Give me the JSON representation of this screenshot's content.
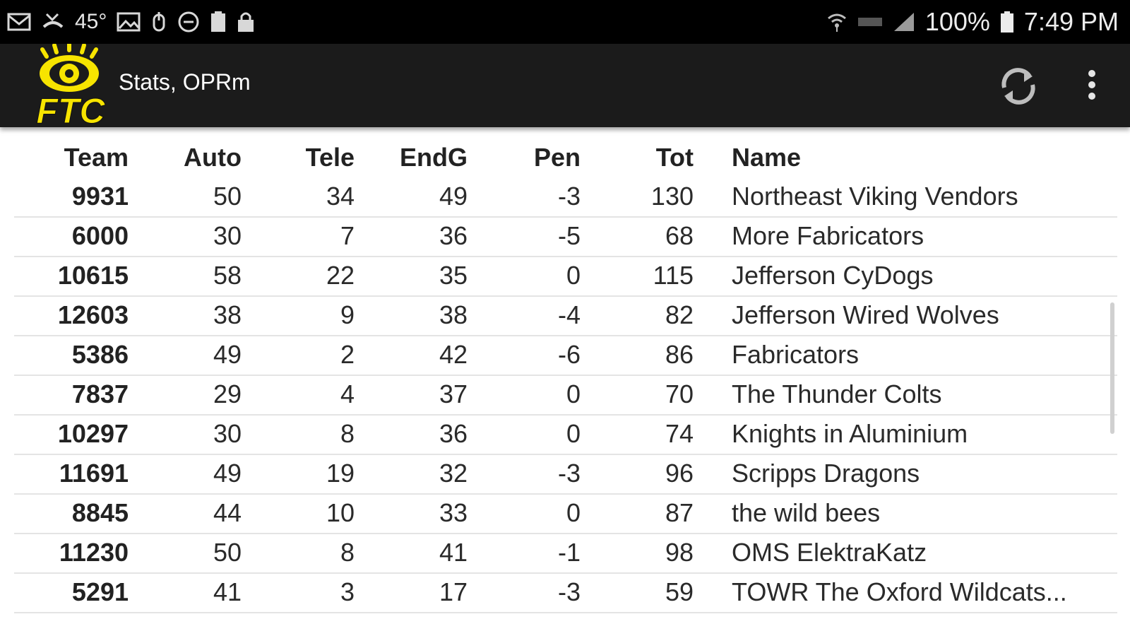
{
  "status_bar": {
    "temperature": "45°",
    "battery": "100%",
    "time": "7:49 PM",
    "left_icons": [
      "mail-icon",
      "missed-call-icon",
      "temperature-icon",
      "image-icon",
      "accessibility-icon",
      "do-not-disturb-icon",
      "clipboard-icon",
      "lock-icon"
    ],
    "right_icons": [
      "wifi-icon",
      "lte-icon",
      "signal-icon",
      "battery-icon"
    ]
  },
  "app_bar": {
    "title": "Stats, OPRm",
    "logo_text": "FTC",
    "accent_color": "#f7e400",
    "background": "#1b1b1b"
  },
  "table": {
    "headers": {
      "team": "Team",
      "auto": "Auto",
      "tele": "Tele",
      "endg": "EndG",
      "pen": "Pen",
      "tot": "Tot",
      "name": "Name"
    },
    "rows": [
      {
        "team": "9931",
        "auto": "50",
        "tele": "34",
        "endg": "49",
        "pen": "-3",
        "tot": "130",
        "name": "Northeast Viking Vendors"
      },
      {
        "team": "6000",
        "auto": "30",
        "tele": "7",
        "endg": "36",
        "pen": "-5",
        "tot": "68",
        "name": "More Fabricators"
      },
      {
        "team": "10615",
        "auto": "58",
        "tele": "22",
        "endg": "35",
        "pen": "0",
        "tot": "115",
        "name": "Jefferson CyDogs"
      },
      {
        "team": "12603",
        "auto": "38",
        "tele": "9",
        "endg": "38",
        "pen": "-4",
        "tot": "82",
        "name": "Jefferson Wired Wolves"
      },
      {
        "team": "5386",
        "auto": "49",
        "tele": "2",
        "endg": "42",
        "pen": "-6",
        "tot": "86",
        "name": "Fabricators"
      },
      {
        "team": "7837",
        "auto": "29",
        "tele": "4",
        "endg": "37",
        "pen": "0",
        "tot": "70",
        "name": "The Thunder Colts"
      },
      {
        "team": "10297",
        "auto": "30",
        "tele": "8",
        "endg": "36",
        "pen": "0",
        "tot": "74",
        "name": "Knights in Aluminium"
      },
      {
        "team": "11691",
        "auto": "49",
        "tele": "19",
        "endg": "32",
        "pen": "-3",
        "tot": "96",
        "name": "Scripps Dragons"
      },
      {
        "team": "8845",
        "auto": "44",
        "tele": "10",
        "endg": "33",
        "pen": "0",
        "tot": "87",
        "name": "the wild bees"
      },
      {
        "team": "11230",
        "auto": "50",
        "tele": "8",
        "endg": "41",
        "pen": "-1",
        "tot": "98",
        "name": "OMS ElektraKatz"
      },
      {
        "team": "5291",
        "auto": "41",
        "tele": "3",
        "endg": "17",
        "pen": "-3",
        "tot": "59",
        "name": "TOWR The Oxford Wildcats..."
      }
    ]
  }
}
